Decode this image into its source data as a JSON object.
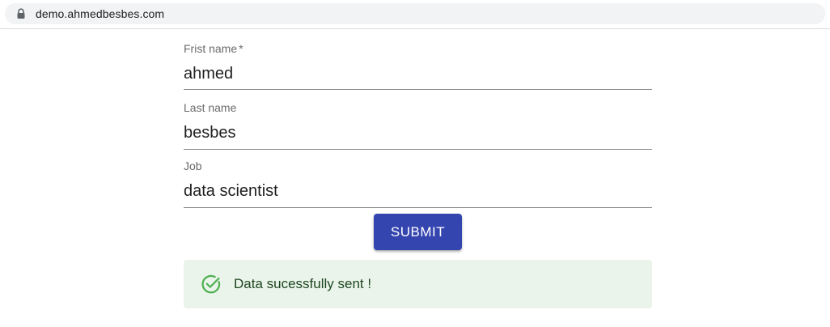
{
  "browser": {
    "url": "demo.ahmedbesbes.com",
    "lock_icon": "lock-icon"
  },
  "form": {
    "fields": [
      {
        "label": "Frist name",
        "required_mark": "*",
        "value": "ahmed"
      },
      {
        "label": "Last name",
        "value": "besbes"
      },
      {
        "label": "Job",
        "value": "data scientist"
      }
    ],
    "submit_label": "SUBMIT"
  },
  "alert": {
    "icon": "check-circle-icon",
    "message": "Data sucessfully sent !"
  },
  "colors": {
    "primary": "#3545b0",
    "success_bg": "#eaf4ea",
    "success_icon": "#4caf50",
    "success_text": "#1e4620"
  }
}
